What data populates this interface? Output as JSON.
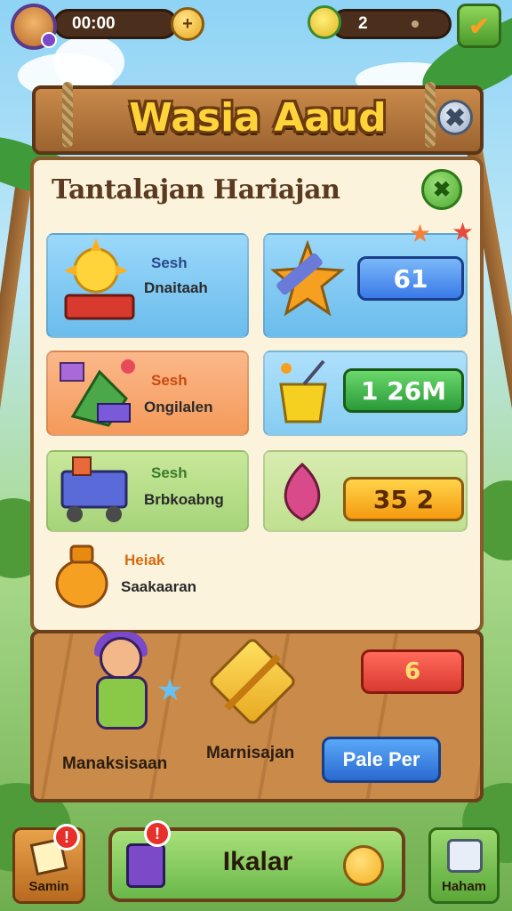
{
  "hud": {
    "timer": "00:00",
    "plus_symbol": "+",
    "counter": "2",
    "confirm_symbol": "✔"
  },
  "header": {
    "title": "Wasia Aaud",
    "close_symbol": "✖"
  },
  "panel": {
    "title": "Tantalajan Hariajan",
    "ok_symbol": "✖"
  },
  "cards": {
    "c1": {
      "top": "Sesh",
      "bottom": "Dnaitaah"
    },
    "c2": {
      "top": "Sesh",
      "bottom": "Ongilalen"
    },
    "c3": {
      "top": "Sesh",
      "bottom": "Brbkoabng"
    },
    "c4": {
      "top": "Heiak",
      "bottom": "Saakaaran"
    }
  },
  "rewards": {
    "r1": "61",
    "r2": "1 26M",
    "r3": "35 2"
  },
  "bottom": {
    "character_label": "Manaksisaan",
    "gift_label": "Marnisajan",
    "ticket_value": "6",
    "action_button": "Pale Per"
  },
  "nav": {
    "left_label": "Samin",
    "left_badge": "!",
    "main_label": "Ikalar",
    "main_badge": "!",
    "right_label": "Haham"
  },
  "colors": {
    "title_gold": "#ffd43a",
    "wood": "#c98a4a",
    "card_blue": "#7cc6f0",
    "card_orange": "#f7a86a",
    "card_green": "#b6dc8a",
    "pill_blue": "#3a7ae8",
    "pill_green": "#3db84a",
    "pill_orange": "#f5a020"
  }
}
